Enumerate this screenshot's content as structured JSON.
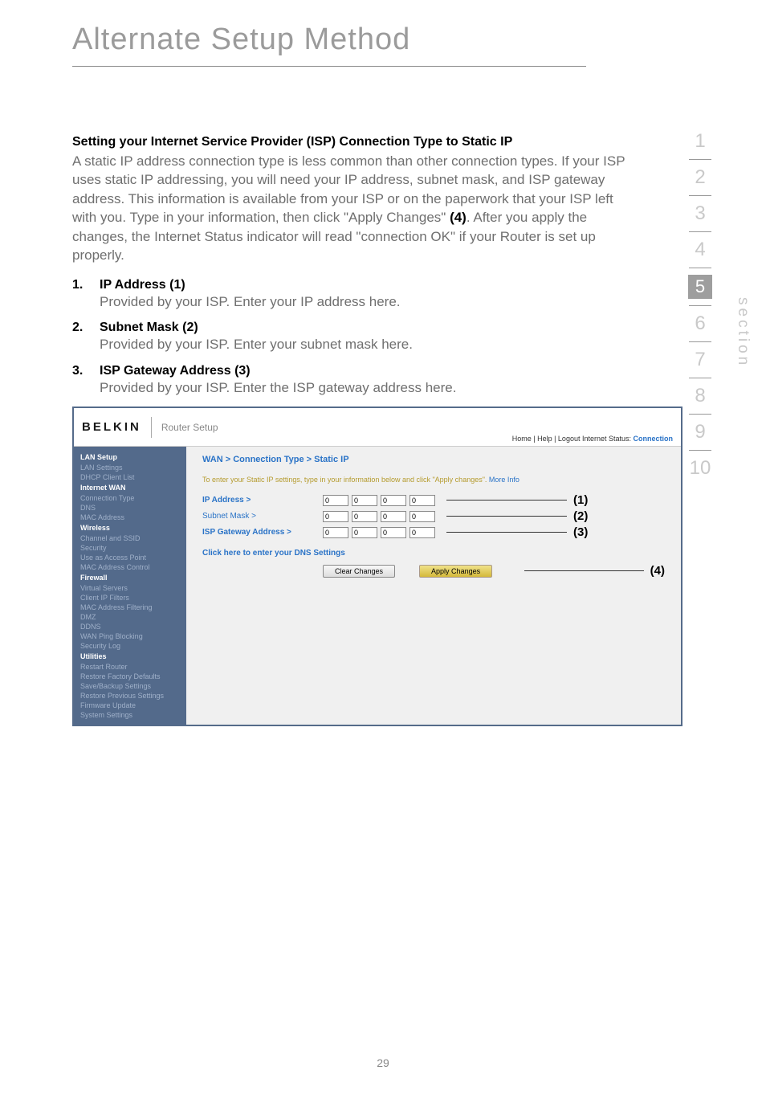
{
  "page_title": "Alternate Setup Method",
  "heading": "Setting your Internet Service Provider (ISP) Connection Type to Static IP",
  "intro_pre": "A static IP address connection type is less common than other connection types. If your ISP uses static IP addressing, you will need your IP address, subnet mask, and ISP gateway address. This information is available from your ISP or on the paperwork that your ISP left with you. Type in your information, then click \"Apply Changes\" ",
  "intro_bold": "(4)",
  "intro_post": ". After you apply the changes, the Internet Status indicator will read \"connection OK\" if your Router is set up properly.",
  "items": [
    {
      "num": "1.",
      "title": "IP Address (1)",
      "text": "Provided by your ISP. Enter your IP address here."
    },
    {
      "num": "2.",
      "title": "Subnet Mask (2)",
      "text": "Provided by your ISP. Enter your subnet mask here."
    },
    {
      "num": "3.",
      "title": "ISP Gateway Address (3)",
      "text": "Provided by your ISP. Enter the ISP gateway address here."
    }
  ],
  "shot": {
    "logo": "BELKIN",
    "subtitle": "Router Setup",
    "toplinks_prefix": "Home | Help | Logout    Internet Status: ",
    "toplinks_status": "Connection",
    "breadcrumb": "WAN > Connection Type > Static IP",
    "instruction": "To enter your Static IP settings, type in your information below and click \"Apply changes\". ",
    "instruction_more": "More Info",
    "rows": [
      {
        "label": "IP Address >",
        "vals": [
          "0",
          "0",
          "0",
          "0"
        ],
        "annot": "(1)"
      },
      {
        "label": "Subnet Mask >",
        "vals": [
          "0",
          "0",
          "0",
          "0"
        ],
        "annot": "(2)"
      },
      {
        "label": "ISP Gateway Address >",
        "vals": [
          "0",
          "0",
          "0",
          "0"
        ],
        "annot": "(3)"
      }
    ],
    "dns_link": "Click here to enter your DNS Settings",
    "btn_clear": "Clear Changes",
    "btn_apply": "Apply Changes",
    "btn_annot": "(4)",
    "sidebar": {
      "groups": [
        {
          "title": "LAN Setup",
          "items": [
            "LAN Settings",
            "DHCP Client List"
          ]
        },
        {
          "title": "Internet WAN",
          "items": [
            "Connection Type",
            "DNS",
            "MAC Address"
          ]
        },
        {
          "title": "Wireless",
          "items": [
            "Channel and SSID",
            "Security",
            "Use as Access Point",
            "MAC Address Control"
          ]
        },
        {
          "title": "Firewall",
          "items": [
            "Virtual Servers",
            "Client IP Filters",
            "MAC Address Filtering",
            "DMZ",
            "DDNS",
            "WAN Ping Blocking",
            "Security Log"
          ]
        },
        {
          "title": "Utilities",
          "items": [
            "Restart Router",
            "Restore Factory Defaults",
            "Save/Backup Settings",
            "Restore Previous Settings",
            "Firmware Update",
            "System Settings"
          ]
        }
      ]
    }
  },
  "sidenav": [
    "1",
    "2",
    "3",
    "4",
    "5",
    "6",
    "7",
    "8",
    "9",
    "10"
  ],
  "sidenav_active_index": 4,
  "section_label": "section",
  "page_number": "29"
}
